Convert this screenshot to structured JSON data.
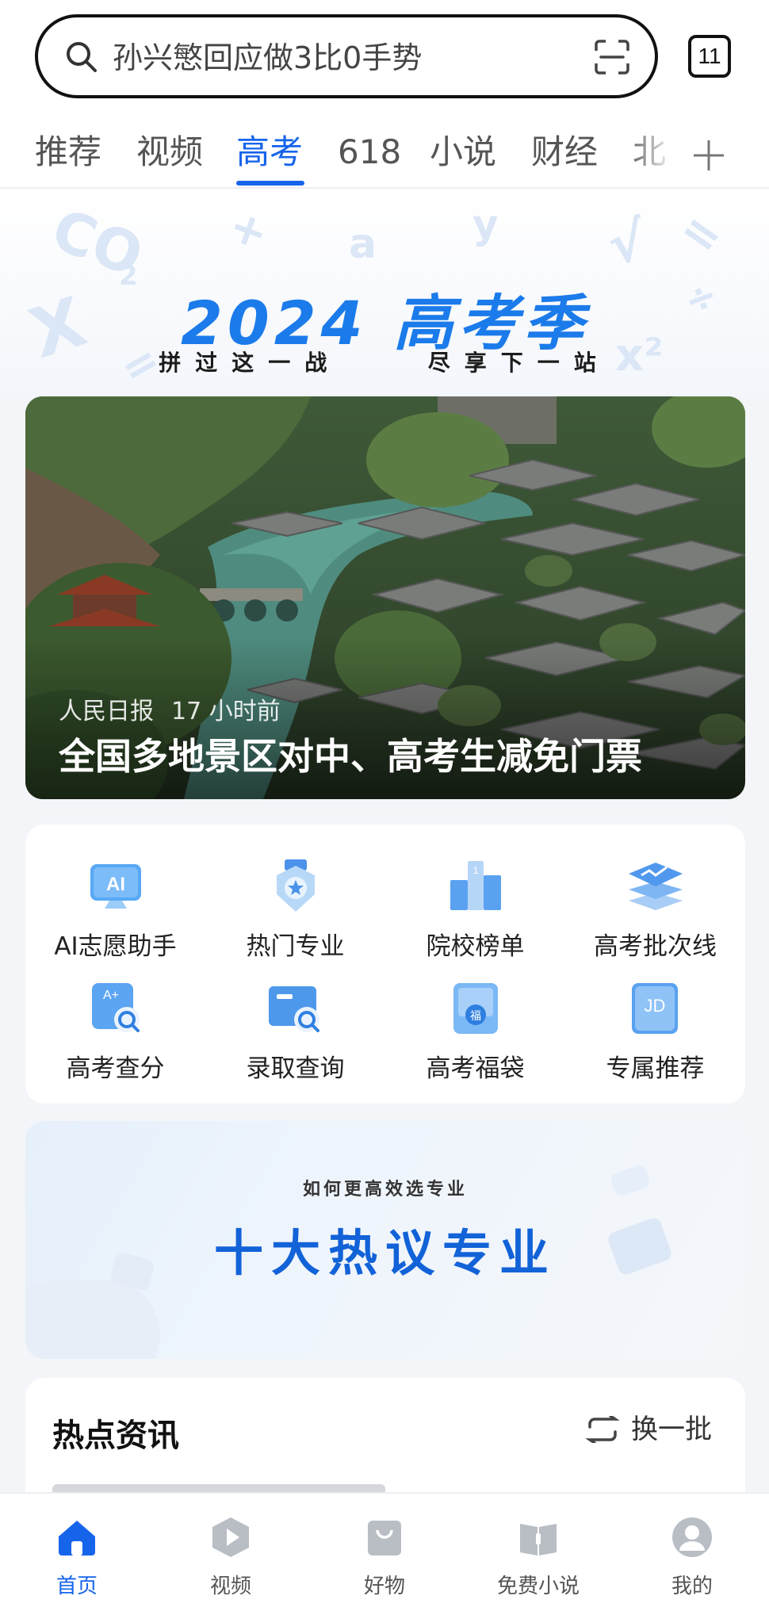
{
  "search": {
    "placeholder": "孙兴慜回应做3比0手势",
    "tab_count": "11"
  },
  "channels": [
    {
      "label": "推荐"
    },
    {
      "label": "视频"
    },
    {
      "label": "高考",
      "active": true
    },
    {
      "label": "618"
    },
    {
      "label": "小说"
    },
    {
      "label": "财经"
    },
    {
      "label": "北"
    }
  ],
  "hero": {
    "title": "2024 高考季",
    "subtitle_left": "拼过这一战",
    "subtitle_right": "尽享下一站"
  },
  "news": {
    "source": "人民日报",
    "time": "17 小时前",
    "headline": "全国多地景区对中、高考生减免门票"
  },
  "tools": [
    {
      "label": "AI志愿助手",
      "icon": "ai-monitor-icon"
    },
    {
      "label": "热门专业",
      "icon": "star-badge-icon"
    },
    {
      "label": "院校榜单",
      "icon": "podium-icon"
    },
    {
      "label": "高考批次线",
      "icon": "layers-chart-icon"
    },
    {
      "label": "高考查分",
      "icon": "score-search-icon"
    },
    {
      "label": "录取查询",
      "icon": "card-search-icon"
    },
    {
      "label": "高考福袋",
      "icon": "lucky-bag-icon"
    },
    {
      "label": "专属推荐",
      "icon": "jd-recommend-icon"
    }
  ],
  "majors_banner": {
    "subtitle": "如何更高效选专业",
    "title": "十大热议专业"
  },
  "hot_news": {
    "title": "热点资讯",
    "refresh_label": "换一批"
  },
  "bottom_nav": [
    {
      "label": "首页",
      "icon": "home-icon",
      "active": true
    },
    {
      "label": "视频",
      "icon": "video-play-icon"
    },
    {
      "label": "好物",
      "icon": "shopping-bag-icon"
    },
    {
      "label": "免费小说",
      "icon": "open-book-icon"
    },
    {
      "label": "我的",
      "icon": "profile-icon"
    }
  ],
  "colors": {
    "accent": "#1664ea",
    "hero_title": "#1b7bea",
    "majors_title": "#1262d8"
  }
}
